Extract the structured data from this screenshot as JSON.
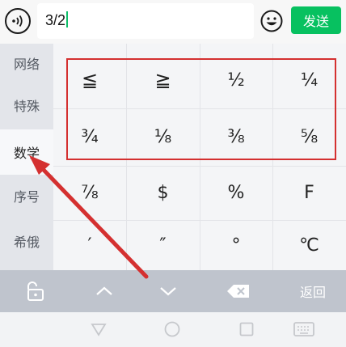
{
  "input_bar": {
    "text": "3/2",
    "send_label": "发送",
    "accent_color": "#07c160"
  },
  "categories": [
    {
      "label": "网络",
      "active": false
    },
    {
      "label": "特殊",
      "active": false
    },
    {
      "label": "数学",
      "active": true
    },
    {
      "label": "序号",
      "active": false
    },
    {
      "label": "希俄",
      "active": false
    }
  ],
  "symbols": [
    [
      "≦",
      "≧",
      "½",
      "¼"
    ],
    [
      "¾",
      "⅛",
      "⅜",
      "⅝"
    ],
    [
      "⅞",
      "$",
      "%",
      "F"
    ],
    [
      "′",
      "″",
      "°",
      "℃"
    ]
  ],
  "function_row": {
    "lock_icon": "unlock-icon",
    "up_icon": "chevron-up-icon",
    "down_icon": "chevron-down-icon",
    "delete_icon": "backspace-icon",
    "back_label": "返回"
  },
  "annotation": {
    "highlight_color": "#d43030"
  }
}
